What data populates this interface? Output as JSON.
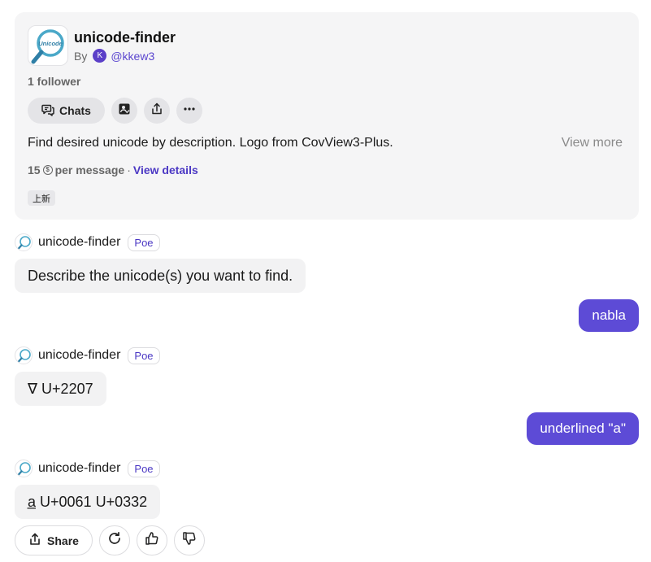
{
  "bot": {
    "name": "unicode-finder",
    "by_label": "By",
    "author_initial": "K",
    "author_handle": "@kkew3",
    "followers": "1 follower",
    "chats_label": "Chats",
    "description": "Find desired unicode by description. Logo from CovView3-Plus.",
    "view_more": "View more",
    "price": "15",
    "price_suffix": "per message",
    "separator": "·",
    "view_details": "View details",
    "tag": "上新",
    "logo_text": "Unicode"
  },
  "messages": [
    {
      "role": "bot",
      "sender": "unicode-finder",
      "badge": "Poe",
      "text": "Describe the unicode(s) you want to find."
    },
    {
      "role": "user",
      "text": "nabla"
    },
    {
      "role": "bot",
      "sender": "unicode-finder",
      "badge": "Poe",
      "text": "∇ U+2207"
    },
    {
      "role": "user",
      "text": "underlined \"a\""
    },
    {
      "role": "bot",
      "sender": "unicode-finder",
      "badge": "Poe",
      "text": "a̲ U+0061 U+0332"
    }
  ],
  "actions": {
    "share_label": "Share",
    "icons": [
      "share-icon",
      "retry-icon",
      "thumbs-up-icon",
      "thumbs-down-icon"
    ]
  },
  "colors": {
    "accent": "#5d4bd6",
    "link": "#4b38c4",
    "card_bg": "#f5f5f6"
  }
}
